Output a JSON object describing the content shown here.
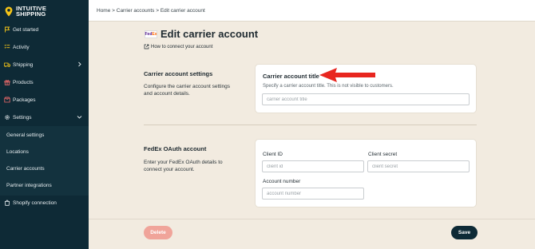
{
  "app": {
    "brand_line1": "INTUITIVE",
    "brand_line2": "SHIPPING"
  },
  "sidebar": {
    "items": [
      {
        "label": "Get started",
        "icon": "flag-icon"
      },
      {
        "label": "Activity",
        "icon": "checklist-icon"
      },
      {
        "label": "Shipping",
        "icon": "truck-icon"
      },
      {
        "label": "Products",
        "icon": "gift-icon"
      },
      {
        "label": "Packages",
        "icon": "package-icon"
      },
      {
        "label": "Settings",
        "icon": "gear-icon"
      }
    ],
    "settings_subitems": [
      {
        "label": "General settings"
      },
      {
        "label": "Locations"
      },
      {
        "label": "Carrier accounts"
      },
      {
        "label": "Partner integrations"
      }
    ],
    "shopify": {
      "label": "Shopify connection",
      "icon": "shopify-icon"
    }
  },
  "breadcrumb": "Home > Carrier accounts > Edit carrier account",
  "page": {
    "title": "Edit carrier account",
    "logo_fe": "Fed",
    "logo_ex": "Ex",
    "help_link": "How to connect your account"
  },
  "carrier_settings": {
    "title": "Carrier account settings",
    "description": "Configure the carrier account settings and account details.",
    "card_title": "Carrier account title",
    "card_subtitle": "Specify a carrier account title. This is not visible to customers.",
    "input_placeholder": "carrier account title",
    "input_value": ""
  },
  "oauth": {
    "title": "FedEx OAuth account",
    "description": "Enter your FedEx OAuth details to connect your account.",
    "client_id_label": "Client ID",
    "client_id_placeholder": "client id",
    "client_secret_label": "Client secret",
    "client_secret_placeholder": "client secret",
    "account_number_label": "Account number",
    "account_number_placeholder": "account number"
  },
  "footer": {
    "delete_label": "Delete",
    "save_label": "Save"
  },
  "colors": {
    "sidebar_bg": "#0e2a36",
    "page_bg": "#f2ebe0",
    "delete_btn": "#f0a49a",
    "save_btn": "#0e2a36",
    "arrow": "#e8261f",
    "logo_pin": "#f5c518"
  }
}
